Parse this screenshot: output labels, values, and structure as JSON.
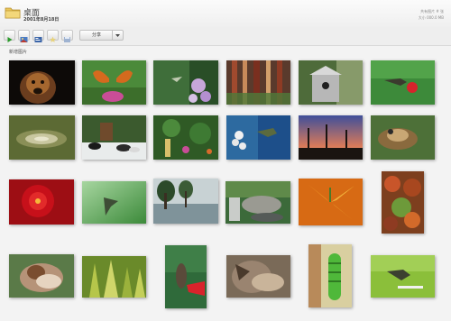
{
  "header": {
    "title": "桌面",
    "date": "2001年8月18日",
    "stats_line1": "共有图片 # 张",
    "stats_line2": "大小 000.0 MB"
  },
  "toolbar": {
    "share_label": "分享",
    "buttons": [
      "play-slideshow",
      "view-photos",
      "view-details",
      "favorites",
      "save"
    ]
  },
  "section": {
    "label": "新增图片"
  },
  "photos": [
    "dog",
    "butterfly",
    "hummingbird-flowers",
    "forest-bark",
    "birdhouse",
    "hummingbird-red-flower",
    "water-ripples",
    "dogs-and-snow",
    "garden-feeder",
    "hummingbird-blossom",
    "sunset-trees",
    "bird-nest",
    "red-rose",
    "hummingbird-green",
    "trees-reflection",
    "rocks-stream",
    "orange-lily",
    "autumn-leaves",
    "sleeping-bird",
    "green-trees",
    "hummingbird-feeder",
    "bird-closeup",
    "caterpillar",
    "hummingbird-grass"
  ],
  "colors": {
    "background": "#f3f3f3",
    "play_green": "#2a9a2a"
  }
}
